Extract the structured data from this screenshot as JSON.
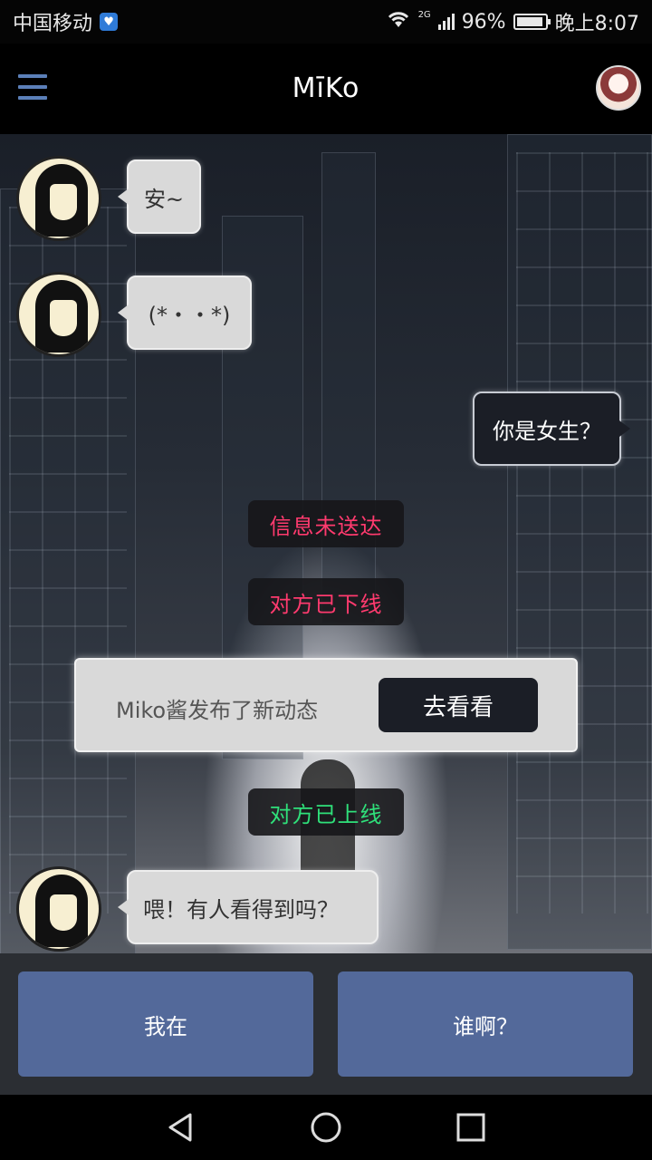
{
  "status_bar": {
    "carrier": "中国移动",
    "network": "2G",
    "battery": "96%",
    "battery_level": 0.96,
    "time": "晚上8:07"
  },
  "header": {
    "title": "MīKo"
  },
  "messages": [
    {
      "side": "left",
      "text": "安~"
    },
    {
      "side": "left",
      "text": "(*・・*)"
    },
    {
      "side": "right",
      "text": "你是女生？"
    },
    {
      "side": "left",
      "text": "喂！有人看得到吗？"
    }
  ],
  "system": {
    "unsent": "信息未送达",
    "offline": "对方已下线",
    "online": "对方已上线"
  },
  "notice": {
    "text": "Miko酱发布了新动态",
    "button": "去看看"
  },
  "replies": {
    "option1": "我在",
    "option2": "谁啊？"
  },
  "colors": {
    "accent": "#53699a",
    "offline": "#ff3a6e",
    "online": "#2fe07a"
  }
}
